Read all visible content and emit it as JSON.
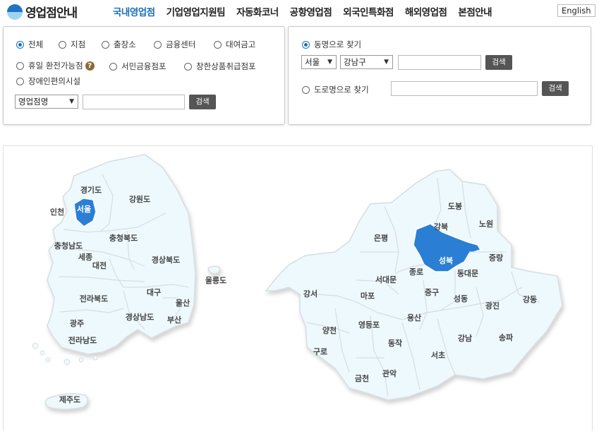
{
  "header": {
    "logo_text": "영업점안내",
    "nav": [
      "국내영업점",
      "기업영업지원팀",
      "자동화코너",
      "공항영업점",
      "외국인특화점",
      "해외영업점",
      "본점안내"
    ],
    "english": "English"
  },
  "left_panel": {
    "filters": [
      "전체",
      "지점",
      "출장소",
      "금융센터",
      "대여금고",
      "휴일 환전가능점",
      "서민금융점포",
      "창한상품취급점포",
      "장애인편의시설"
    ],
    "help": "?",
    "select_value": "영업점명",
    "search_btn": "검색"
  },
  "right_panel": {
    "option1": "동명으로 찾기",
    "city": "서울",
    "district": "강남구",
    "search_btn1": "검색",
    "option2": "도로명으로 찾기",
    "search_btn2": "검색"
  },
  "korea_map": {
    "labels": [
      "경기도",
      "강원도",
      "인천",
      "서울",
      "충청북도",
      "충청남도",
      "세종",
      "대전",
      "경상북도",
      "울릉도",
      "대구",
      "전라북도",
      "울산",
      "광주",
      "경상남도",
      "부산",
      "전라남도",
      "제주도"
    ],
    "selected": "서울"
  },
  "seoul_map": {
    "labels": [
      "도봉",
      "노원",
      "은평",
      "강북",
      "성북",
      "중랑",
      "종로",
      "동대문",
      "서대문",
      "강서",
      "마포",
      "중구",
      "성동",
      "광진",
      "강동",
      "양천",
      "영등포",
      "용산",
      "송파",
      "강남",
      "구로",
      "동작",
      "서초",
      "금천",
      "관악"
    ],
    "selected": "성북"
  },
  "colors": {
    "accent": "#1a6fbe",
    "region_fill": "#eef9fd",
    "region_selected": "#2b7fd4",
    "button": "#555555"
  }
}
